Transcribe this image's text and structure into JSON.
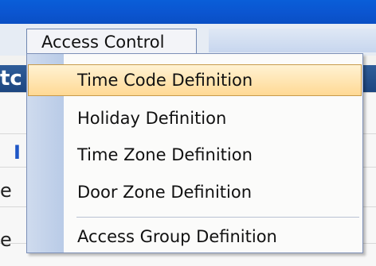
{
  "menubar": {
    "active_menu": "Access Control"
  },
  "background": {
    "header_text": "tc",
    "row_glyphs": [
      "I",
      "e",
      "e"
    ]
  },
  "menu": {
    "items": [
      {
        "label": "Time Code Definition",
        "selected": true
      },
      {
        "label": "Holiday Definition",
        "selected": false
      },
      {
        "label": "Time Zone Definition",
        "selected": false
      },
      {
        "label": "Door Zone Definition",
        "selected": false
      },
      {
        "label": "Access Group Definition",
        "selected": false
      }
    ]
  }
}
